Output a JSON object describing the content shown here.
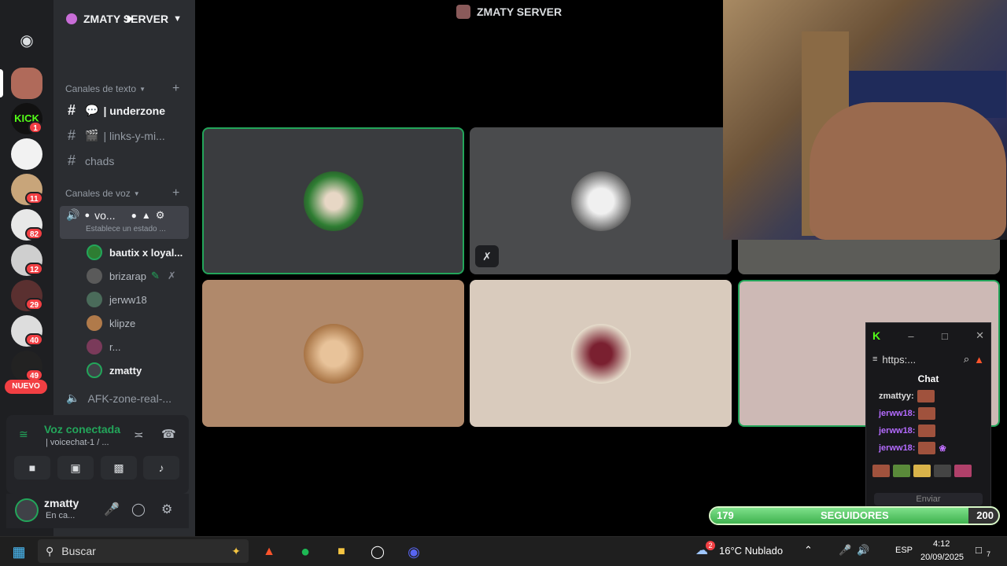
{
  "colors": {
    "accent_green": "#23a55a",
    "kick_green": "#53fc18",
    "badge_red": "#f23f43",
    "followers_fill": "#3fb24f"
  },
  "server": {
    "name": "ZMATY SERVER"
  },
  "categories": {
    "text": "Canales de texto",
    "voice": "Canales de voz"
  },
  "text_channels": [
    {
      "name": "| underzone",
      "active": true
    },
    {
      "name": "| links-y-mi...",
      "active": false
    },
    {
      "name": "chads",
      "active": false
    }
  ],
  "voice_channel": {
    "name": "vo...",
    "status": "Establece un estado ..."
  },
  "members": [
    {
      "name": "bautix x loyal...",
      "bold": true,
      "color": "#2e7d32"
    },
    {
      "name": "brizarap",
      "bold": false,
      "color": "#5a5a5a"
    },
    {
      "name": "jerww18",
      "bold": false,
      "color": "#4a6b5a"
    },
    {
      "name": "klipze",
      "bold": false,
      "color": "#b07a4a"
    },
    {
      "name": "r...",
      "bold": false,
      "color": "#7a3a5a"
    },
    {
      "name": "zmatty",
      "bold": true,
      "color": "#3f4147"
    }
  ],
  "afk_channel": "AFK-zone-real-...",
  "voice_panel": {
    "title": "Voz conectada",
    "subtitle": "| voicechat-1 / ..."
  },
  "user": {
    "name": "zmatty",
    "status": "En ca..."
  },
  "rail_badges": [
    "1",
    "11",
    "82",
    "12",
    "29",
    "40",
    "49"
  ],
  "rail_new": "NUEVO",
  "main": {
    "title": "ZMATY SERVER"
  },
  "kick": {
    "url": "https:...",
    "chat_title": "Chat",
    "messages": [
      {
        "user": "zmattyy:"
      },
      {
        "user": "jerww18:"
      },
      {
        "user": "jerww18:"
      },
      {
        "user": "jerww18:"
      }
    ],
    "send": "Enviar"
  },
  "followers": {
    "current": "179",
    "label": "SEGUIDORES",
    "goal": "200",
    "fraction": 0.895
  },
  "taskbar": {
    "search": "Buscar",
    "weather": "16°C Nublado",
    "lang": "ESP",
    "time": "4:12",
    "date": "20/09/2025",
    "weather_badge": "2",
    "notif": "7"
  }
}
